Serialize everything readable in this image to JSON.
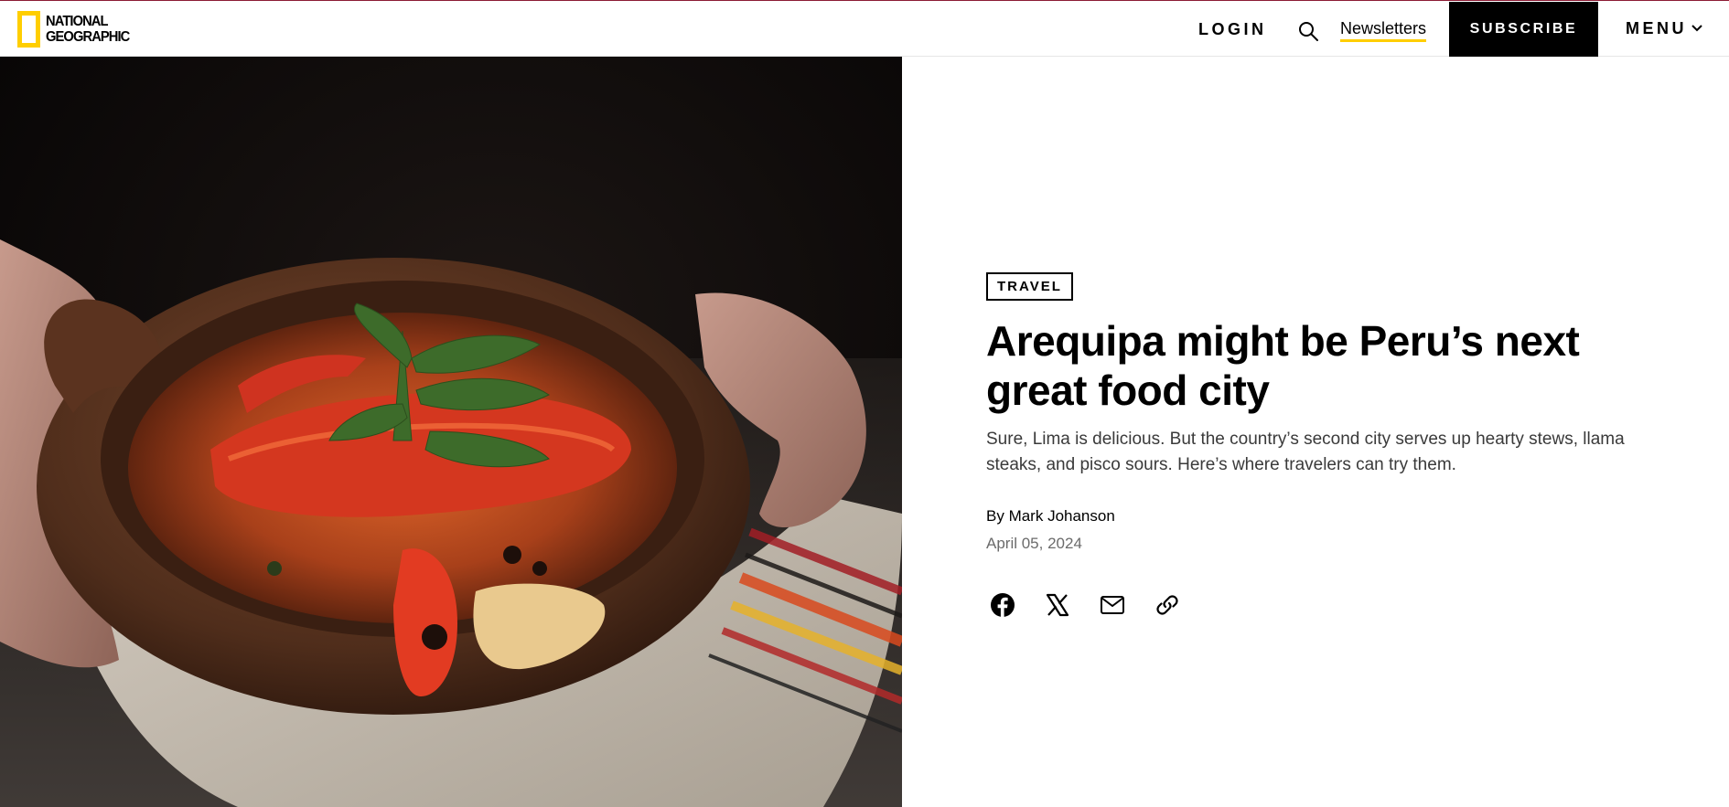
{
  "header": {
    "logo_line1": "NATIONAL",
    "logo_line2": "GEOGRAPHIC",
    "login": "LOGIN",
    "search_icon": "search-icon",
    "newsletters": "Newsletters",
    "subscribe": "SUBSCRIBE",
    "menu": "MENU",
    "menu_icon": "chevron-down-icon"
  },
  "hero": {
    "image": "clay-pot-of-crayfish-stew-held-in-hands"
  },
  "article": {
    "category": "TRAVEL",
    "headline": "Arequipa might be Peru’s next great food city",
    "dek": "Sure, Lima is delicious. But the country’s second city serves up hearty stews, llama steaks, and pisco sours. Here’s where travelers can try them.",
    "byline_prefix": "By ",
    "author": "Mark Johanson",
    "date": "April 05, 2024"
  },
  "share": [
    {
      "icon": "facebook-icon"
    },
    {
      "icon": "x-icon"
    },
    {
      "icon": "email-icon"
    },
    {
      "icon": "link-icon"
    }
  ],
  "colors": {
    "brand_yellow": "#ffce00",
    "top_accent": "#8c1c35",
    "subscribe_bg": "#000000",
    "dek_text": "#3a3a3a",
    "date_text": "#6b6b6b"
  }
}
